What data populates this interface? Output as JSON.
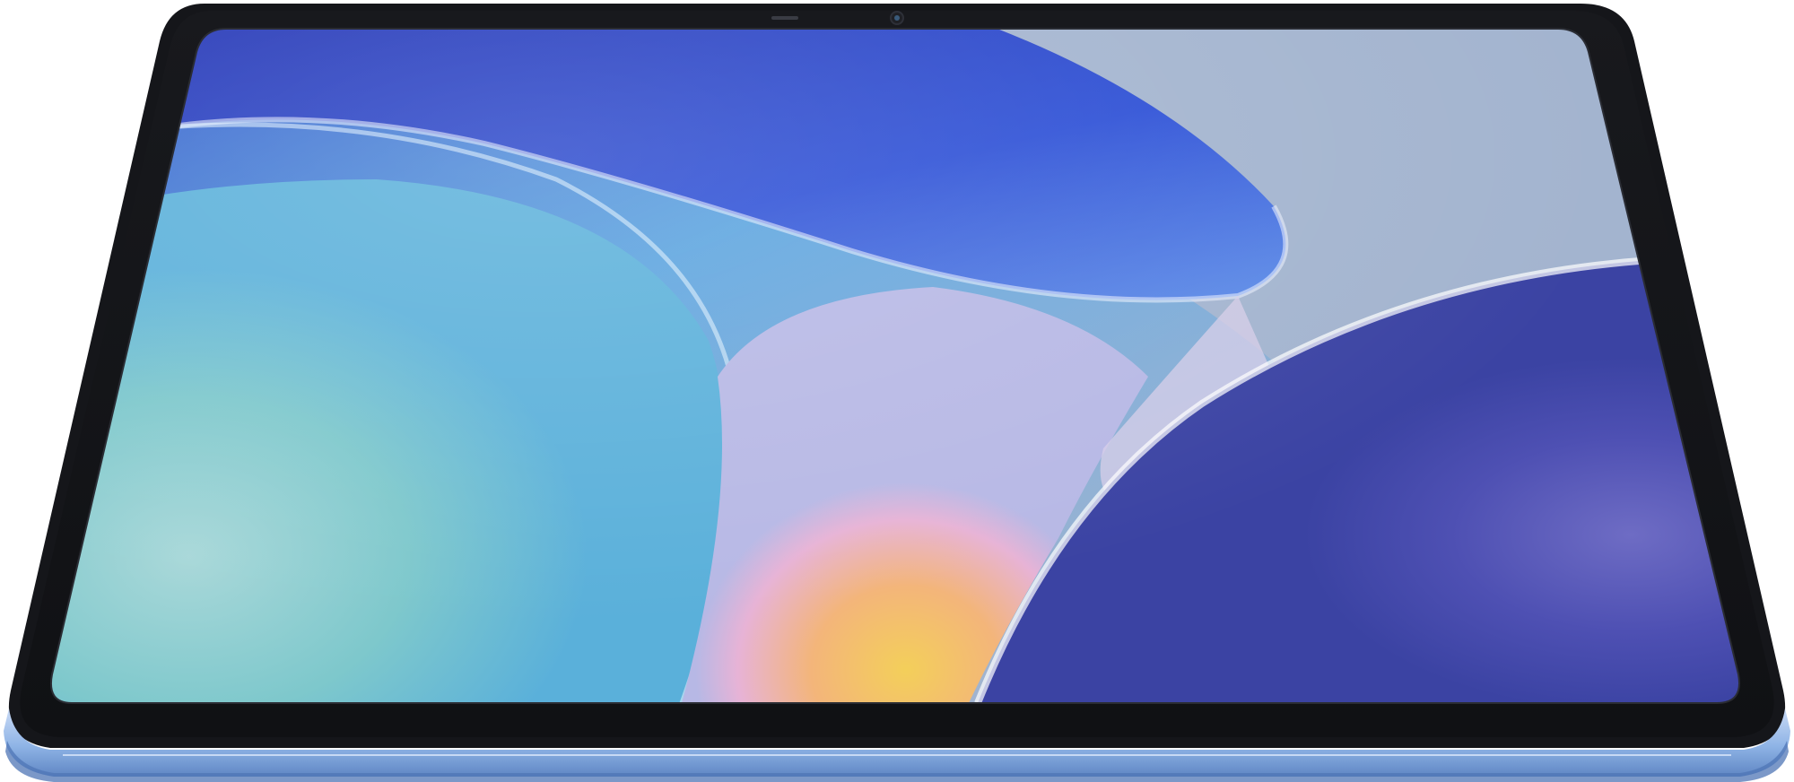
{
  "scene": {
    "subject": "tablet",
    "texts": []
  },
  "colors": {
    "background": "#ffffff",
    "frame_blue": "#8fb4e6",
    "frame_blue_dark": "#5f86c4",
    "bezel": "#141519",
    "screen_deep_blue": "#2a45c7",
    "screen_gray_blue": "#a3b4cf",
    "screen_teal": "#7ec8cc",
    "screen_pink": "#e7b3d6",
    "screen_orange": "#f3b57a",
    "screen_yellow": "#f0cd63",
    "screen_violet": "#4e50b3"
  },
  "icons": [
    "camera-icon",
    "speaker-slot-icon"
  ]
}
